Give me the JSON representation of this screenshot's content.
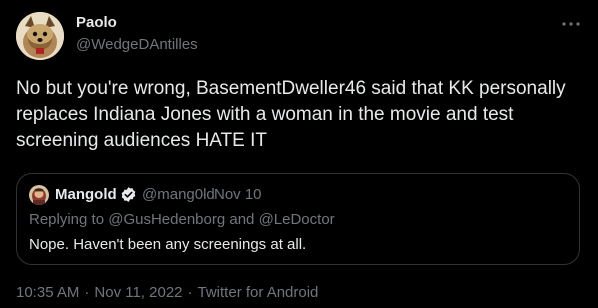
{
  "author": {
    "name": "Paolo",
    "handle": "@WedgeDAntilles",
    "avatar_icon": "yorkie-dog-avatar"
  },
  "tweet": {
    "text": "No but you're wrong, BasementDweller46 said that KK personally replaces Indiana Jones with a woman in the movie and test screening audiences HATE IT"
  },
  "quoted_tweet": {
    "author_name": "Mangold",
    "verified_icon": "verified-badge-icon",
    "handle": "@mang0ld",
    "separator": "·",
    "date": "Nov 10",
    "replying_prefix": "Replying to",
    "replying_users": [
      "@GusHedenborg",
      "@LeDoctor"
    ],
    "replying_joiner": "and",
    "text": "Nope. Haven't been any screenings at all."
  },
  "meta": {
    "time": "10:35 AM",
    "separator": "·",
    "date": "Nov 11, 2022",
    "source": "Twitter for Android"
  },
  "colors": {
    "background": "#000000",
    "primary_text": "#e7e9ea",
    "secondary_text": "#71767b",
    "border": "#2f3336",
    "verified": "#1d9bf0"
  }
}
